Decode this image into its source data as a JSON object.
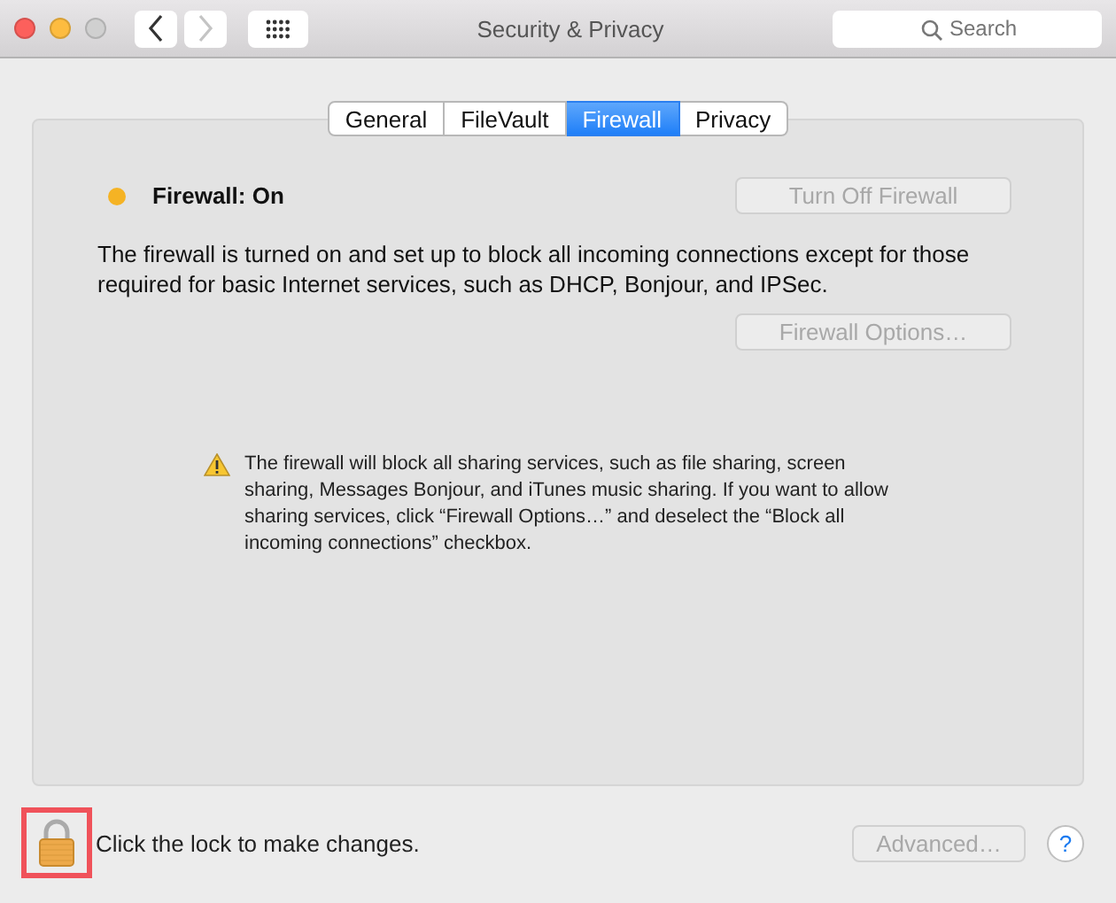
{
  "window": {
    "title": "Security & Privacy",
    "zoom_disabled": true
  },
  "toolbar": {
    "back_disabled": false,
    "forward_disabled": true,
    "search": {
      "placeholder": "Search"
    }
  },
  "tabs": [
    {
      "label": "General",
      "selected": false
    },
    {
      "label": "FileVault",
      "selected": false
    },
    {
      "label": "Firewall",
      "selected": true
    },
    {
      "label": "Privacy",
      "selected": false
    }
  ],
  "firewall": {
    "status": "Firewall: On",
    "on": true,
    "toggle_button": {
      "label": "Turn Off Firewall",
      "disabled": true
    },
    "description": "The firewall is turned on and set up to block all incoming connections except for those required for basic Internet services, such as DHCP, Bonjour, and IPSec.",
    "options_button": {
      "label": "Firewall Options…",
      "disabled": true
    },
    "warning": "The firewall will block all sharing services, such as file sharing, screen sharing, Messages Bonjour, and iTunes music sharing.  If you want to allow sharing services, click “Firewall Options…” and deselect the “Block all incoming connections” checkbox."
  },
  "footer": {
    "lock_highlighted": true,
    "lock_text": "Click the lock to make changes.",
    "advanced_button": {
      "label": "Advanced…",
      "disabled": true
    },
    "help": "?"
  }
}
